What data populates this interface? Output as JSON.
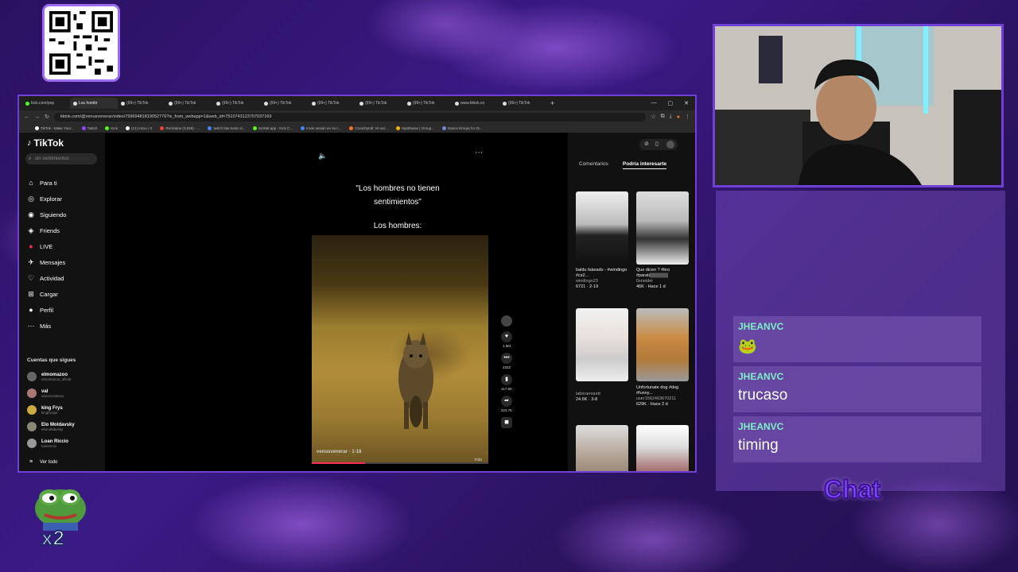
{
  "browser": {
    "tabs": [
      {
        "label": "kick.com/pop"
      },
      {
        "label": "Los hombr"
      },
      {
        "label": "(99+) TikTok"
      },
      {
        "label": "(99+) TikTok"
      },
      {
        "label": "(99+) TikTok"
      },
      {
        "label": "(99+) TikTok"
      },
      {
        "label": "(99+) TikTok"
      },
      {
        "label": "(99+) TikTok"
      },
      {
        "label": "(99+) TikTok"
      },
      {
        "label": "www.tiktok.co"
      },
      {
        "label": "(99+) TikTok"
      }
    ],
    "url": "tiktok.com/@venusvenerar/video/75969481819052776?is_from_webapp=1&web_id=7510743123707037169",
    "bookmarks": [
      "TikTok - Make Your...",
      "Twitch",
      "Kick",
      "(21) Inicio / X",
      "Recibidos (3,628) - ...",
      "twitch bits botón d...",
      "Kicklet.app - Kick C...",
      "Inicie sesión en su c...",
      "Crunchyroll: Ve ani...",
      "HqrdNoise | Group...",
      "Dance Emojis for Di..."
    ]
  },
  "tiktok": {
    "logo": "TikTok",
    "search_placeholder": "sin sentimientos",
    "nav": [
      {
        "label": "Para ti",
        "icon": "home-icon"
      },
      {
        "label": "Explorar",
        "icon": "compass-icon"
      },
      {
        "label": "Siguiendo",
        "icon": "following-icon"
      },
      {
        "label": "Friends",
        "icon": "friends-icon"
      },
      {
        "label": "LIVE",
        "icon": "live-icon"
      },
      {
        "label": "Mensajes",
        "icon": "message-icon"
      },
      {
        "label": "Actividad",
        "icon": "activity-icon"
      },
      {
        "label": "Cargar",
        "icon": "upload-icon"
      },
      {
        "label": "Perfil",
        "icon": "profile-icon"
      },
      {
        "label": "Más",
        "icon": "more-icon"
      }
    ],
    "following_title": "Cuentas que sigues",
    "following": [
      {
        "name": "elmomazoo",
        "handle": "elmomazoo_oficial"
      },
      {
        "name": "val",
        "handle": "valconzalesss"
      },
      {
        "name": "king Frys",
        "handle": "kingfryspe"
      },
      {
        "name": "Elo Moldavsky",
        "handle": "elomoldavsky"
      },
      {
        "name": "Loan Riccio",
        "handle": "loanriccio"
      }
    ],
    "see_all": "Ver todo",
    "caption_line1": "\"Los hombres no tienen",
    "caption_line2": "sentimientos\"",
    "caption_sub": "Los hombres:",
    "video_user": "venusvenerar · 1-18",
    "video_more": "más",
    "actions": [
      {
        "icon": "heart-icon",
        "count": "1.5M"
      },
      {
        "icon": "comment-icon",
        "count": "2322"
      },
      {
        "icon": "bookmark-icon",
        "count": "117.6K"
      },
      {
        "icon": "share-icon",
        "count": "223.7K"
      }
    ],
    "progress": 0.3,
    "right_tabs": [
      "Comentarios",
      "Podría interesarte"
    ],
    "recommended": [
      {
        "title": "baldu fakeado - #windingo #cs2...",
        "user": "windingo23",
        "stats": "6721 · 2-19"
      },
      {
        "title": "Que dicen ? #bro #parati▒▒▒▒▒▒",
        "user": "0sneider",
        "stats": "46K · Hace 1 d"
      },
      {
        "title": "",
        "user": "labirramorett",
        "stats": "24.6K · 3-8"
      },
      {
        "title": "Unfortunate dog #dog #funny...",
        "user": "user1562463670211",
        "stats": "629K · Hace 2 d"
      },
      {
        "title": "",
        "user": "",
        "stats": ""
      },
      {
        "title": "",
        "user": "",
        "stats": ""
      }
    ]
  },
  "chat": {
    "messages": [
      {
        "user": "JHEANVC",
        "text": "🐸"
      },
      {
        "user": "JHEANVC",
        "text": "trucaso"
      },
      {
        "user": "JHEANVC",
        "text": "timing"
      }
    ],
    "label": "Chat"
  },
  "overlay": {
    "multiplier": "x2"
  }
}
